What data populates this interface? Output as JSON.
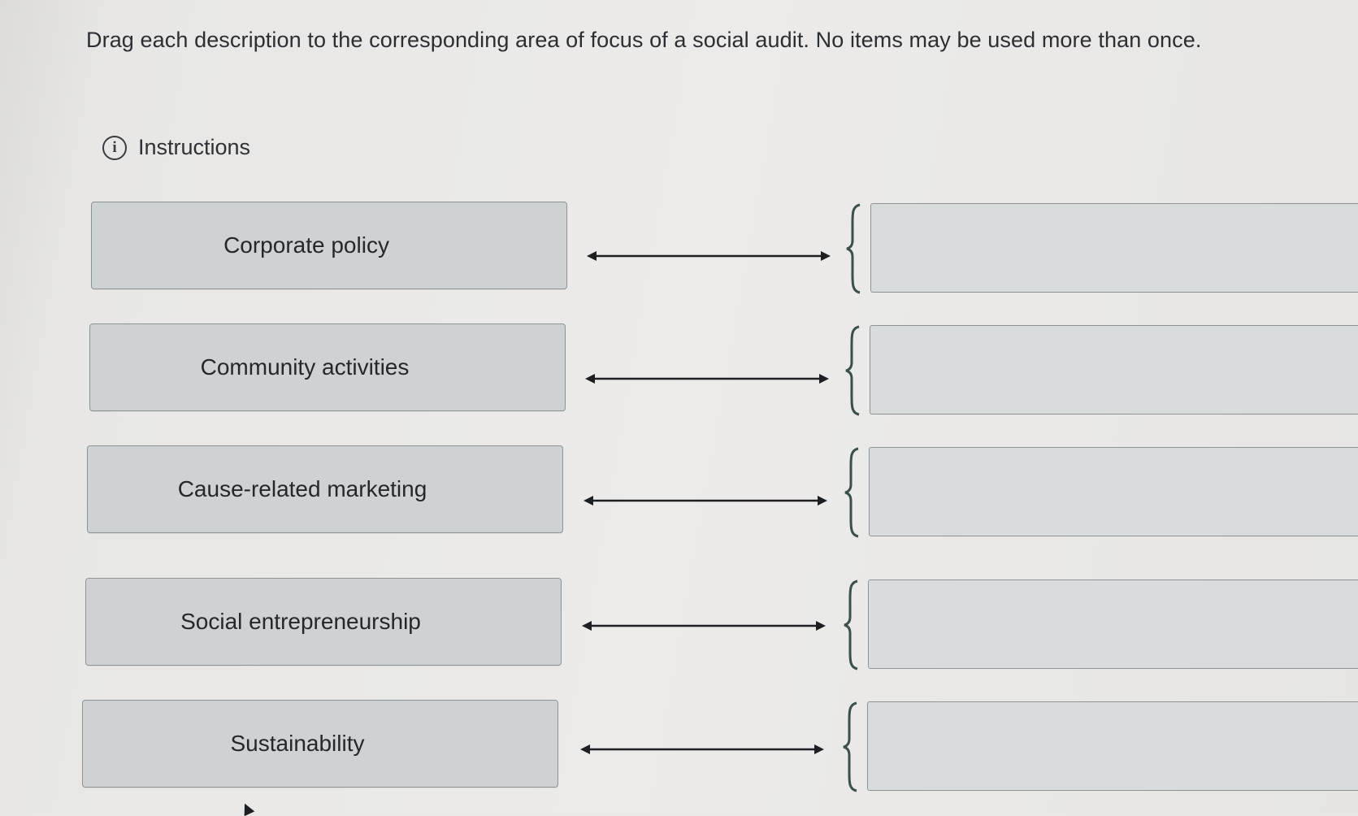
{
  "prompt": "Drag each description to the corresponding area of focus of a social audit. No items may be used more than once.",
  "instructions": {
    "icon": "info-icon",
    "icon_glyph": "i",
    "label": "Instructions"
  },
  "items": [
    {
      "label": "Corporate policy"
    },
    {
      "label": "Community activities"
    },
    {
      "label": "Cause-related marketing"
    },
    {
      "label": "Social entrepreneurship"
    },
    {
      "label": "Sustainability"
    }
  ],
  "dropzones": [
    {
      "value": ""
    },
    {
      "value": ""
    },
    {
      "value": ""
    },
    {
      "value": ""
    },
    {
      "value": ""
    }
  ],
  "colors": {
    "item_fill": "#cfd2d2",
    "item_border": "#8e9394",
    "brace": "#3b4f4b",
    "arrow": "#1e1f22"
  }
}
